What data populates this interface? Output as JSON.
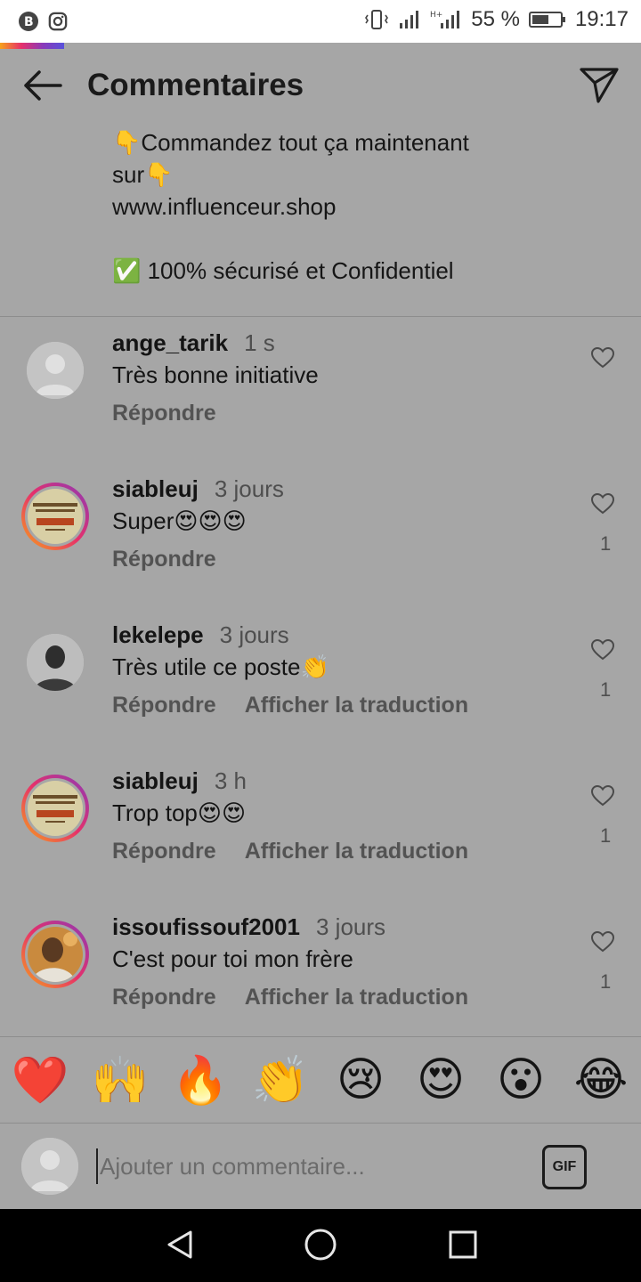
{
  "status_bar": {
    "battery_percent": "55 %",
    "time": "19:17",
    "left_icons": [
      "b-coin-icon",
      "instagram-icon"
    ]
  },
  "header": {
    "title": "Commentaires"
  },
  "caption": {
    "line1": "👇Commandez tout ça maintenant",
    "line2": "sur👇",
    "line3": " www.influenceur.shop",
    "line4": "✅ 100% sécurisé et Confidentiel"
  },
  "comments": [
    {
      "username": "ange_tarik",
      "time": "1 s",
      "text": "Très bonne initiative",
      "reply": "Répondre",
      "translate": "",
      "likes": ""
    },
    {
      "username": "siableuj",
      "time": "3 jours",
      "text": "Super😍😍😍",
      "reply": "Répondre",
      "translate": "",
      "likes": "1"
    },
    {
      "username": "lekelepe",
      "time": "3 jours",
      "text": "Très utile ce poste👏",
      "reply": "Répondre",
      "translate": "Afficher la traduction",
      "likes": "1"
    },
    {
      "username": "siableuj",
      "time": "3 h",
      "text": "Trop top😍😍",
      "reply": "Répondre",
      "translate": "Afficher la traduction",
      "likes": "1"
    },
    {
      "username": "issoufissouf2001",
      "time": "3 jours",
      "text": "C'est pour toi mon frère",
      "reply": "Répondre",
      "translate": "Afficher la traduction",
      "likes": "1"
    }
  ],
  "emoji_bar": [
    "❤️",
    "🙌",
    "🔥",
    "👏",
    "😢",
    "😍",
    "😮",
    "😂"
  ],
  "composer": {
    "placeholder": "Ajouter un commentaire...",
    "gif_label": "GIF"
  },
  "colors": {
    "story_ring_start": "#f7a21b",
    "story_ring_mid": "#e6306b",
    "story_ring_end": "#8a3ab9"
  }
}
